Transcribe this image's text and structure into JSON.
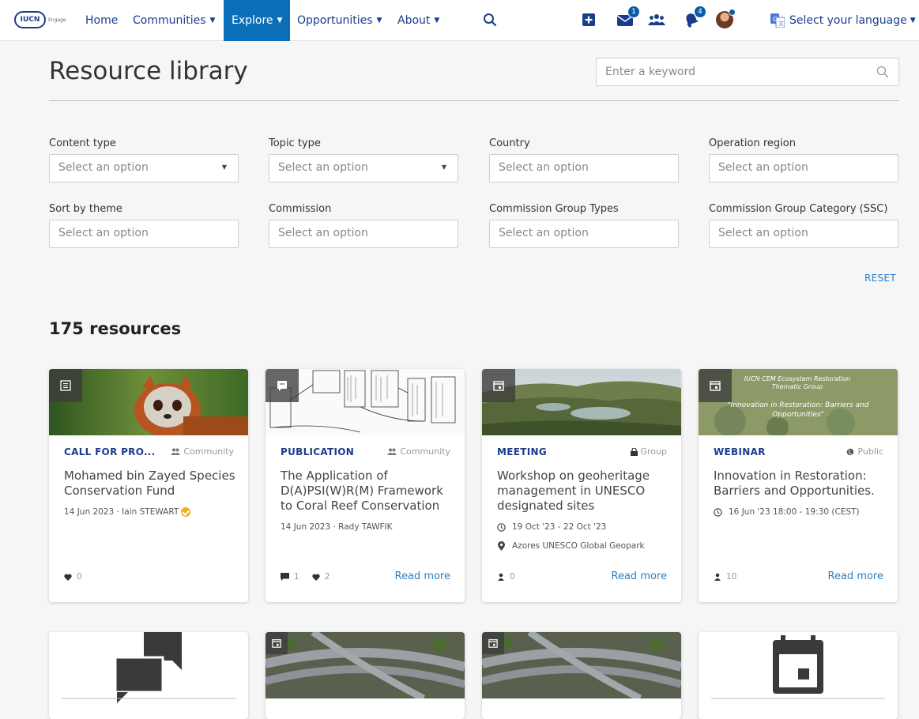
{
  "nav": {
    "logo_text": "IUCN",
    "logo_sub": "Engage",
    "items": [
      {
        "label": "Home",
        "caret": ""
      },
      {
        "label": "Communities",
        "caret": "▼"
      },
      {
        "label": "Explore",
        "caret": "▼"
      },
      {
        "label": "Opportunities",
        "caret": "▼"
      },
      {
        "label": "About",
        "caret": "▼"
      }
    ],
    "messages_badge": "1",
    "notifications_badge": "4",
    "language_label": "Select your language",
    "language_caret": "▼"
  },
  "header": {
    "title": "Resource library",
    "search_placeholder": "Enter a keyword"
  },
  "filters": [
    {
      "label": "Content type",
      "placeholder": "Select an option",
      "caret": "▼"
    },
    {
      "label": "Topic type",
      "placeholder": "Select an option",
      "caret": "▼"
    },
    {
      "label": "Country",
      "placeholder": "Select an option"
    },
    {
      "label": "Operation region",
      "placeholder": "Select an option"
    },
    {
      "label": "Sort by theme",
      "placeholder": "Select an option"
    },
    {
      "label": "Commission",
      "placeholder": "Select an option"
    },
    {
      "label": "Commission Group Types",
      "placeholder": "Select an option"
    },
    {
      "label": "Commission Group Category (SSC)",
      "placeholder": "Select an option"
    }
  ],
  "reset_label": "RESET",
  "results_count": "175 resources",
  "cards": [
    {
      "type": "CALL FOR PRO...",
      "visibility": "Community",
      "title": "Mohamed bin Zayed Species Conservation Fund",
      "meta": "14 Jun 2023 · Iain STEWART",
      "likes": "0",
      "image": "red-panda"
    },
    {
      "type": "PUBLICATION",
      "visibility": "Community",
      "title": "The Application of D(A)PSI(W)R(M) Framework to Coral Reef Conservation",
      "meta": "14 Jun 2023 · Rady TAWFIK",
      "comments": "1",
      "likes": "2",
      "read_more": "Read more",
      "image": "diagram"
    },
    {
      "type": "MEETING",
      "visibility": "Group",
      "title": "Workshop on geoheritage management in UNESCO designated sites",
      "date": "19 Oct '23 - 22 Oct '23",
      "location": "Azores UNESCO Global Geopark",
      "attendees": "0",
      "read_more": "Read more",
      "image": "landscape"
    },
    {
      "type": "WEBINAR",
      "visibility": "Public",
      "title": "Innovation in Restoration: Barriers and Opportunities.",
      "date": "16 Jun '23 18:00 - 19:30 (CEST)",
      "attendees": "10",
      "read_more": "Read more",
      "image": "banner",
      "banner_line1": "IUCN CEM Ecosystem Restoration Thematic Group",
      "banner_line2": "\"Innovation in Restoration: Barriers and Opportunities\""
    }
  ],
  "colors": {
    "nav_text": "#1a3c8c",
    "nav_active_bg": "#0a6fb8",
    "link": "#2c7fc4",
    "type_label": "#1a3c8c"
  }
}
